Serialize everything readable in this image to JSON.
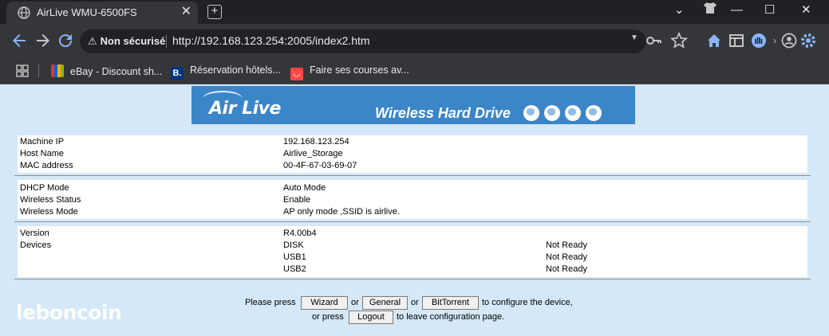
{
  "browser": {
    "tab_title": "AirLive WMU-6500FS",
    "tab_close": "✕",
    "new_tab": "+",
    "window": {
      "chevron": "⌄",
      "minimize": "—",
      "maximize": "☐",
      "close": "✕"
    },
    "security_label": "Non sécurisé",
    "url": "http://192.168.123.254:2005/index2.htm",
    "icons": [
      "back-icon",
      "forward-icon",
      "reload-icon",
      "key-icon",
      "star-icon",
      "home-icon",
      "reader-icon",
      "extension-icon",
      "account-icon",
      "settings-icon"
    ],
    "bookmarks": [
      {
        "label": "eBay - Discount sh...",
        "icon": "ebay-icon",
        "color": "#e53238"
      },
      {
        "label": "Réservation hôtels...",
        "icon": "booking-icon",
        "color": "#003580"
      },
      {
        "label": "Faire ses courses av...",
        "icon": "aliexpress-icon",
        "color": "#ff4747"
      }
    ]
  },
  "banner": {
    "logo": "Air Live",
    "tagline": "Wireless Hard Drive"
  },
  "info": {
    "network": [
      {
        "label": "Machine IP",
        "value": "192.168.123.254"
      },
      {
        "label": "Host Name",
        "value": "Airlive_Storage"
      },
      {
        "label": "MAC address",
        "value": "00-4F-67-03-69-07"
      }
    ],
    "wireless": [
      {
        "label": "DHCP Mode",
        "value": "Auto Mode"
      },
      {
        "label": "Wireless Status",
        "value": "Enable"
      },
      {
        "label": "Wireless Mode",
        "value": "AP only mode ,SSID is airlive."
      }
    ],
    "system": {
      "version_label": "Version",
      "version_value": "R4.00b4",
      "devices_label": "Devices",
      "devices": [
        {
          "name": "DISK",
          "status": "Not Ready"
        },
        {
          "name": "USB1",
          "status": "Not Ready"
        },
        {
          "name": "USB2",
          "status": "Not Ready"
        }
      ]
    }
  },
  "footer": {
    "please_press": "Please press",
    "or1": "or",
    "or2": "or",
    "to_configure": "to configure the device,",
    "or_press": "or press",
    "to_leave": "to leave configuration page.",
    "wizard": "Wizard",
    "general": "General",
    "bittorrent": "BitTorrent",
    "logout": "Logout"
  },
  "watermark": "leboncoin",
  "colors": {
    "page_bg": "#d5e8f7",
    "banner_bg": "#3b85c9",
    "chrome_dark": "#202124",
    "chrome_mid": "#35363a"
  }
}
